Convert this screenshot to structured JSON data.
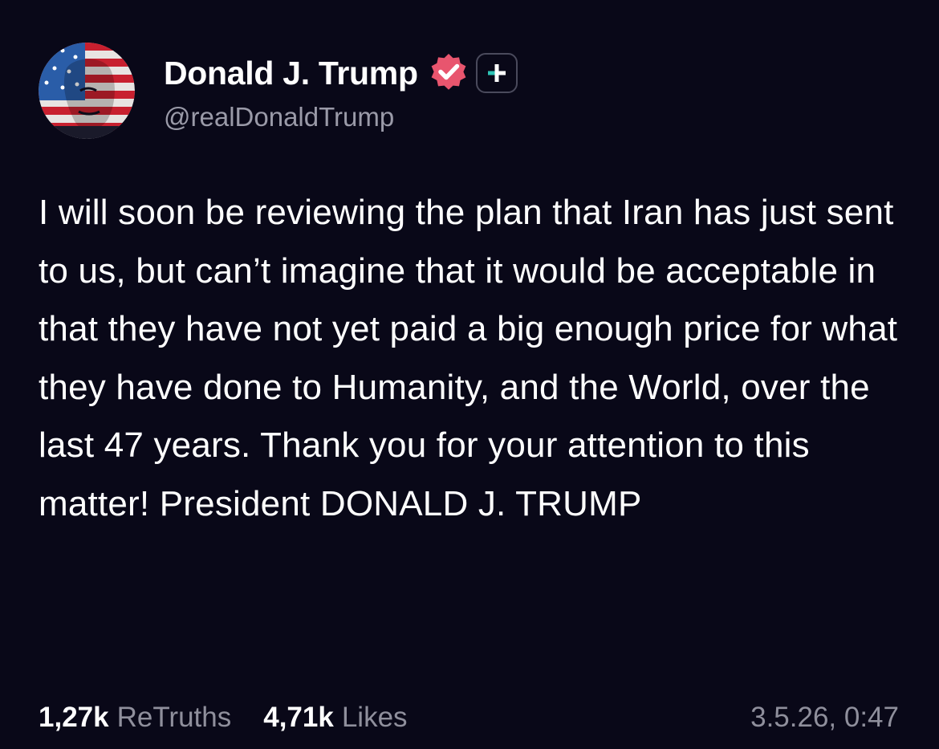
{
  "post": {
    "author": {
      "display_name": "Donald J. Trump",
      "handle": "@realDonaldTrump",
      "verified": true,
      "avatar_icon": "flag-portrait-avatar"
    },
    "follow_icon": "plus-icon",
    "text": "I will soon be reviewing the plan that Iran has just sent to us, but can’t imagine that it would be acceptable in that they have not yet paid a big enough price for what they have done to Humanity, and the World, over the last 47 years. Thank you for your attention to this matter! President DONALD J. TRUMP",
    "stats": {
      "retruths_count": "1,27k",
      "retruths_label": "ReTruths",
      "likes_count": "4,71k",
      "likes_label": "Likes"
    },
    "timestamp": "3.5.26, 0:47"
  },
  "colors": {
    "background": "#090818",
    "verified_badge": "#e8556e",
    "plus_accent": "#2ec4b6",
    "muted_text": "#8f8f9c"
  }
}
